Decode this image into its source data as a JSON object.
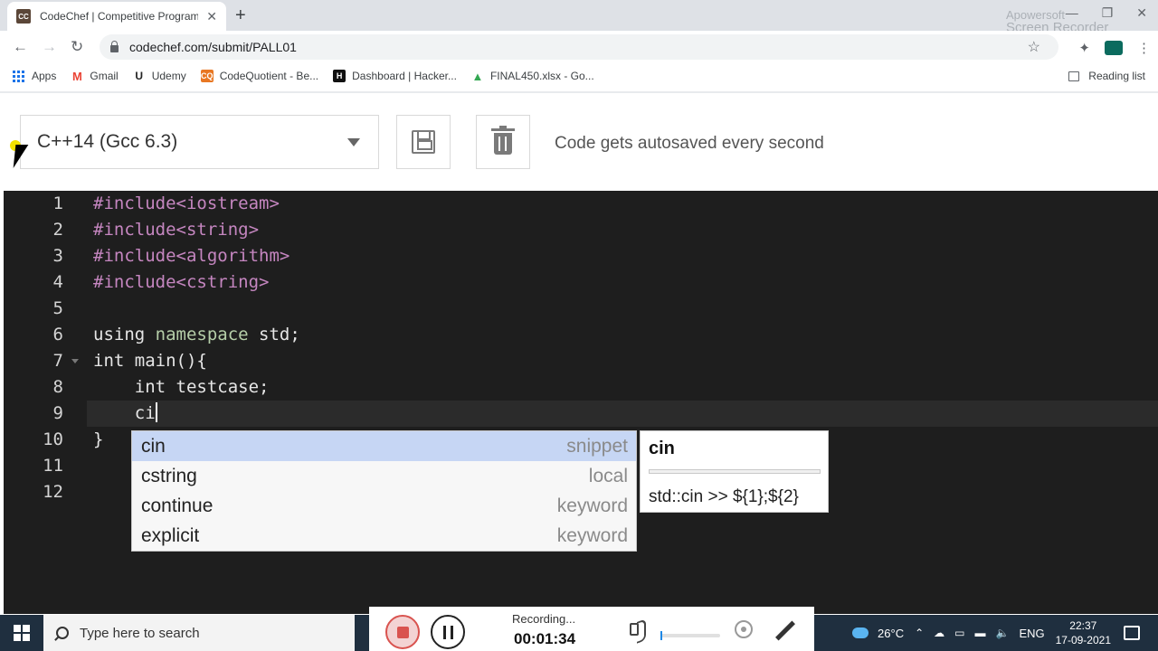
{
  "browser": {
    "tab_title": "CodeChef | Competitive Program",
    "tab_favicon": "CC",
    "url": "codechef.com/submit/PALL01",
    "watermark_line1": "Apowersoft",
    "watermark_line2": "Screen Recorder",
    "bookmarks": [
      {
        "label": "Apps",
        "icon": "apps-grid-icon"
      },
      {
        "label": "Gmail",
        "icon": "gmail-icon",
        "glyph": "M",
        "color": "#ea4335"
      },
      {
        "label": "Udemy",
        "icon": "udemy-icon",
        "glyph": "U",
        "color": "#a435f0"
      },
      {
        "label": "CodeQuotient - Be...",
        "icon": "codequotient-icon",
        "glyph": "CQ",
        "color": "#e87722"
      },
      {
        "label": "Dashboard | Hacker...",
        "icon": "hackerrank-icon",
        "glyph": "H",
        "color": "#111111"
      },
      {
        "label": "FINAL450.xlsx - Go...",
        "icon": "drive-icon",
        "glyph": "▲",
        "color": "#34a853"
      }
    ],
    "reading_list": "Reading list"
  },
  "editor_header": {
    "language": "C++14 (Gcc 6.3)",
    "autosave_note": "Code gets autosaved every second"
  },
  "code": {
    "lines": [
      {
        "num": "1",
        "text": "#include<iostream>"
      },
      {
        "num": "2",
        "text": "#include<string>"
      },
      {
        "num": "3",
        "text": "#include<algorithm>"
      },
      {
        "num": "4",
        "text": "#include<cstring>"
      },
      {
        "num": "5",
        "text": ""
      },
      {
        "num": "6",
        "text": "using namespace std;"
      },
      {
        "num": "7",
        "text": "int main(){"
      },
      {
        "num": "8",
        "text": "    int testcase;"
      },
      {
        "num": "9",
        "text": "    ci"
      },
      {
        "num": "10",
        "text": "}"
      },
      {
        "num": "11",
        "text": ""
      },
      {
        "num": "12",
        "text": ""
      }
    ]
  },
  "autocomplete": {
    "items": [
      {
        "label": "cin",
        "meta": "snippet"
      },
      {
        "label": "cstring",
        "meta": "local"
      },
      {
        "label": "continue",
        "meta": "keyword"
      },
      {
        "label": "explicit",
        "meta": "keyword"
      }
    ],
    "doc_title": "cin",
    "doc_body": "std::cin >> ${1};${2}"
  },
  "taskbar": {
    "search_placeholder": "Type here to search",
    "recording_status": "Recording...",
    "recording_time": "00:01:34",
    "volume_level": 0.0,
    "temperature": "26°C",
    "language": "ENG",
    "time": "22:37",
    "date": "17-09-2021"
  },
  "colors": {
    "editor_bg": "#1e1e1e",
    "preprocessor": "#c586c0",
    "namespace": "#b5cea8",
    "autocomplete_selected": "#c6d6f4"
  }
}
